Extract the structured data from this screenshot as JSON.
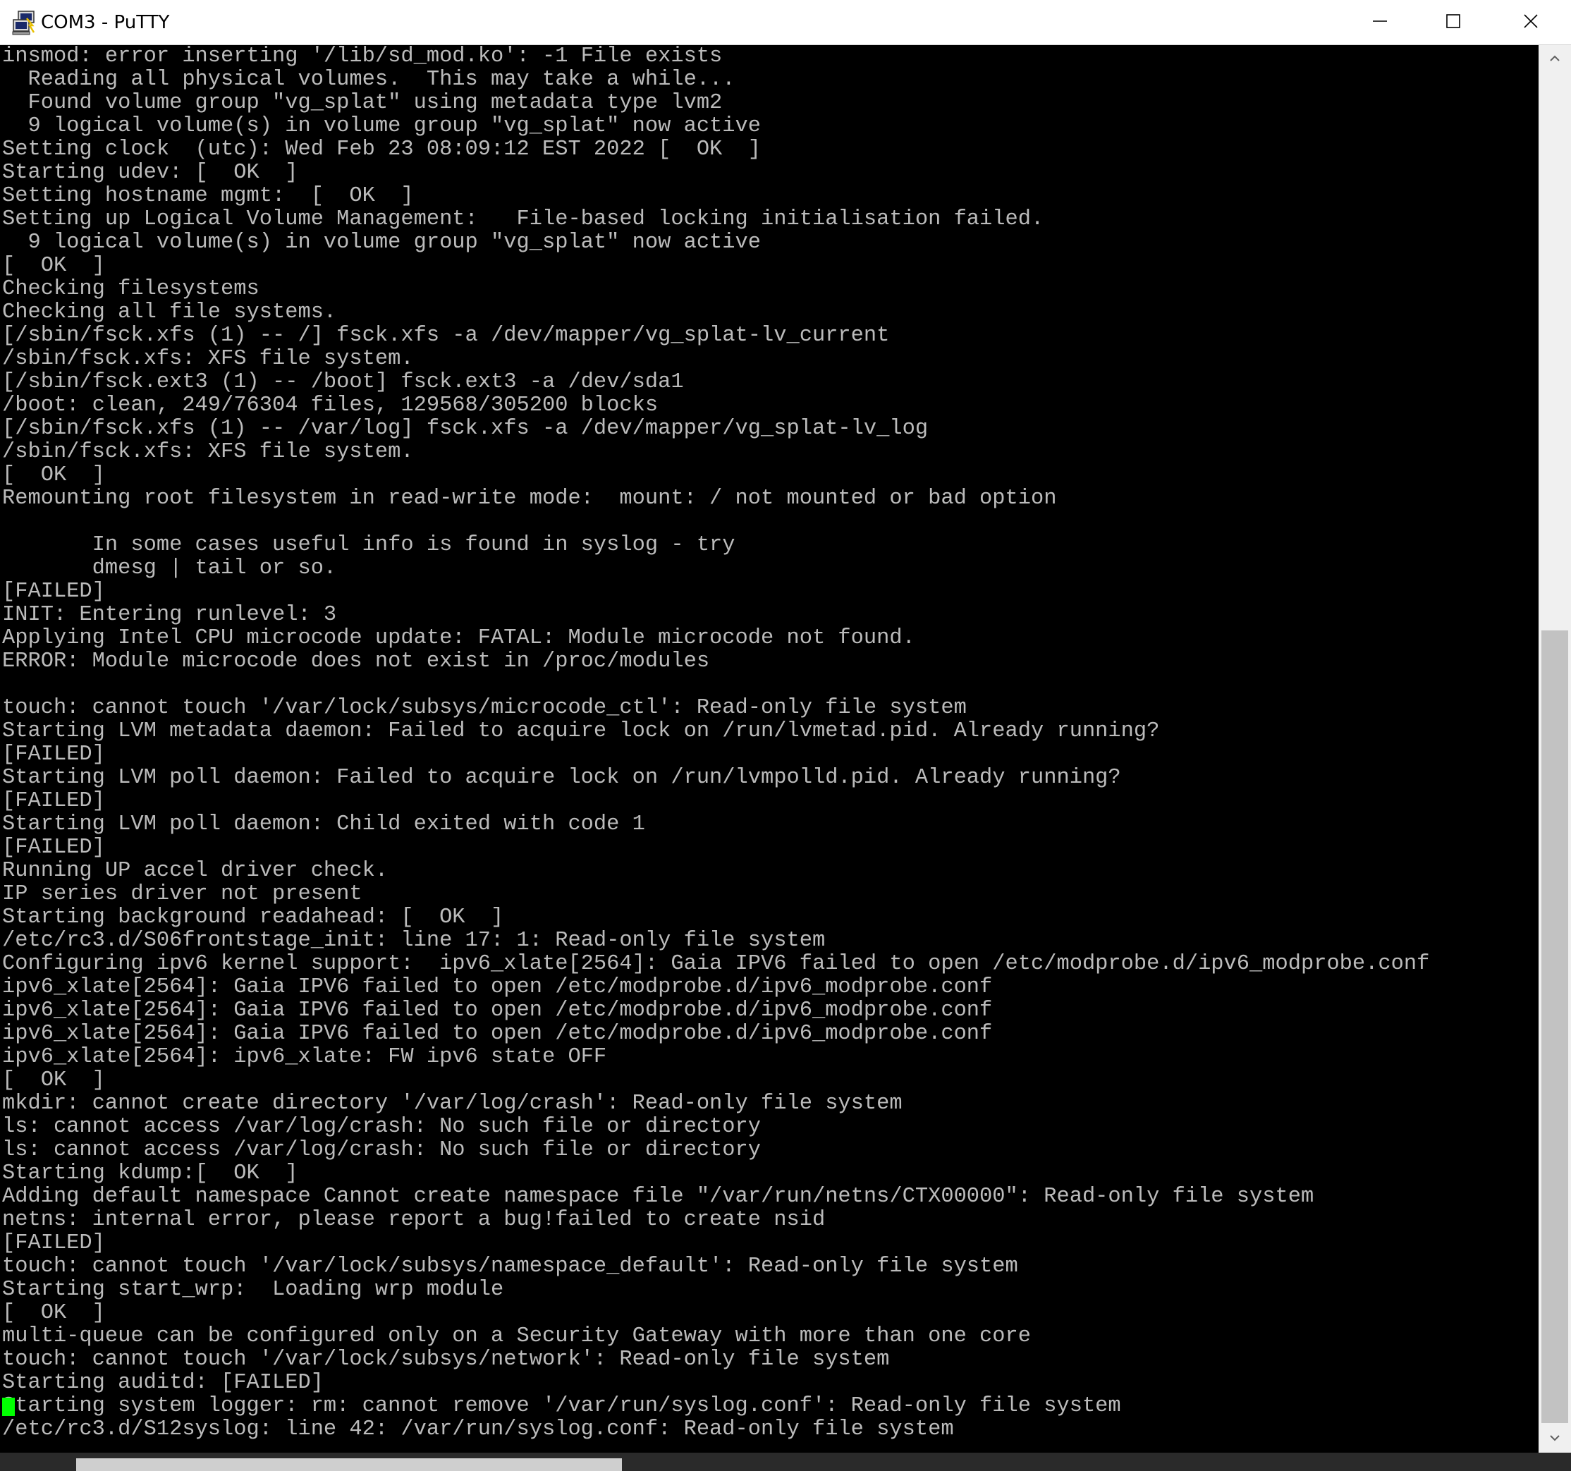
{
  "window": {
    "title": "COM3 - PuTTY",
    "icons": {
      "app": "putty-terminal-icon",
      "minimize": "minimize-icon",
      "maximize": "maximize-icon",
      "close": "close-icon"
    }
  },
  "terminal": {
    "foreground": "#bbbbbb",
    "background": "#000000",
    "cursor_color": "#00ff00",
    "lines": [
      "insmod: error inserting '/lib/sd_mod.ko': -1 File exists",
      "  Reading all physical volumes.  This may take a while...",
      "  Found volume group \"vg_splat\" using metadata type lvm2",
      "  9 logical volume(s) in volume group \"vg_splat\" now active",
      "Setting clock  (utc): Wed Feb 23 08:09:12 EST 2022 [  OK  ]",
      "Starting udev: [  OK  ]",
      "Setting hostname mgmt:  [  OK  ]",
      "Setting up Logical Volume Management:   File-based locking initialisation failed.",
      "  9 logical volume(s) in volume group \"vg_splat\" now active",
      "[  OK  ]",
      "Checking filesystems",
      "Checking all file systems.",
      "[/sbin/fsck.xfs (1) -- /] fsck.xfs -a /dev/mapper/vg_splat-lv_current",
      "/sbin/fsck.xfs: XFS file system.",
      "[/sbin/fsck.ext3 (1) -- /boot] fsck.ext3 -a /dev/sda1",
      "/boot: clean, 249/76304 files, 129568/305200 blocks",
      "[/sbin/fsck.xfs (1) -- /var/log] fsck.xfs -a /dev/mapper/vg_splat-lv_log",
      "/sbin/fsck.xfs: XFS file system.",
      "[  OK  ]",
      "Remounting root filesystem in read-write mode:  mount: / not mounted or bad option",
      "",
      "       In some cases useful info is found in syslog - try",
      "       dmesg | tail or so.",
      "[FAILED]",
      "INIT: Entering runlevel: 3",
      "Applying Intel CPU microcode update: FATAL: Module microcode not found.",
      "ERROR: Module microcode does not exist in /proc/modules",
      "",
      "touch: cannot touch '/var/lock/subsys/microcode_ctl': Read-only file system",
      "Starting LVM metadata daemon: Failed to acquire lock on /run/lvmetad.pid. Already running?",
      "[FAILED]",
      "Starting LVM poll daemon: Failed to acquire lock on /run/lvmpolld.pid. Already running?",
      "[FAILED]",
      "Starting LVM poll daemon: Child exited with code 1",
      "[FAILED]",
      "Running UP accel driver check.",
      "IP series driver not present",
      "Starting background readahead: [  OK  ]",
      "/etc/rc3.d/S06frontstage_init: line 17: 1: Read-only file system",
      "Configuring ipv6 kernel support:  ipv6_xlate[2564]: Gaia IPV6 failed to open /etc/modprobe.d/ipv6_modprobe.conf",
      "ipv6_xlate[2564]: Gaia IPV6 failed to open /etc/modprobe.d/ipv6_modprobe.conf",
      "ipv6_xlate[2564]: Gaia IPV6 failed to open /etc/modprobe.d/ipv6_modprobe.conf",
      "ipv6_xlate[2564]: Gaia IPV6 failed to open /etc/modprobe.d/ipv6_modprobe.conf",
      "ipv6_xlate[2564]: ipv6_xlate: FW ipv6 state OFF",
      "[  OK  ]",
      "mkdir: cannot create directory '/var/log/crash': Read-only file system",
      "ls: cannot access /var/log/crash: No such file or directory",
      "ls: cannot access /var/log/crash: No such file or directory",
      "Starting kdump:[  OK  ]",
      "Adding default namespace Cannot create namespace file \"/var/run/netns/CTX00000\": Read-only file system",
      "netns: internal error, please report a bug!failed to create nsid",
      "[FAILED]",
      "touch: cannot touch '/var/lock/subsys/namespace_default': Read-only file system",
      "Starting start_wrp:  Loading wrp module",
      "[  OK  ]",
      "multi-queue can be configured only on a Security Gateway with more than one core",
      "touch: cannot touch '/var/lock/subsys/network': Read-only file system",
      "Starting auditd: [FAILED]",
      "Starting system logger: rm: cannot remove '/var/run/syslog.conf': Read-only file system",
      "/etc/rc3.d/S12syslog: line 42: /var/run/syslog.conf: Read-only file system"
    ]
  },
  "scrollbar": {
    "up_icon": "scroll-up-arrow-icon",
    "down_icon": "scroll-down-arrow-icon"
  }
}
